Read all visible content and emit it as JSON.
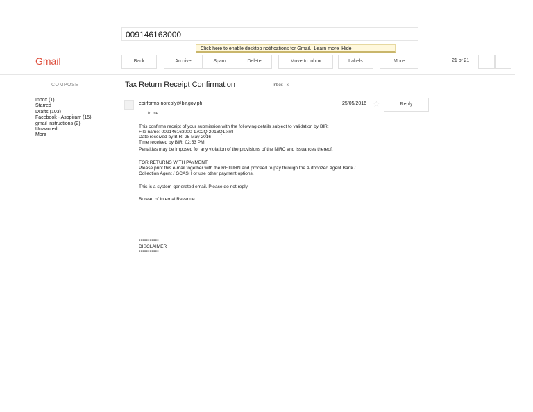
{
  "search": {
    "value": "009146163000"
  },
  "notification": {
    "link": "Click here to enable",
    "text": " desktop notifications for Gmail.",
    "learn_more": "Learn more",
    "hide": "Hide"
  },
  "logo": "Gmail",
  "toolbar": {
    "back": "Back",
    "archive": "Archive",
    "spam": "Spam",
    "delete": "Delete",
    "move_to_inbox": "Move to Inbox",
    "labels": "Labels",
    "more": "More",
    "pager": "21 of 21"
  },
  "compose": "COMPOSE",
  "nav": [
    "Inbox (1)",
    "Starred",
    "Drafts (103)",
    "Facebook - Asopiram (15)",
    "gmail instructions (2)",
    "Unwanted",
    "More"
  ],
  "message": {
    "subject": "Tax Return Receipt Confirmation",
    "label": "Inbox",
    "label_x": "x",
    "sender": "ebirforms-noreply@bir.gov.ph",
    "to": "to me",
    "date": "25/05/2016",
    "reply": "Reply",
    "body": {
      "p1": [
        "This confirms receipt of your submission with the following details subject to validation by BIR:",
        "File name:     009146163000-1702Q-2016Q1.xml",
        "Date received by BIR:   25 May 2016",
        "Time received by BIR:   02:53 PM",
        "Penalties may be imposed for any violation of the provisions of the NIRC and issuances thereof."
      ],
      "p2": [
        "FOR RETURNS WITH PAYMENT",
        "Please print this e-mail together with the RETURN and proceed to pay through the Authorized Agent Bank /",
        "Collection Agent / GCASH or use other payment options."
      ],
      "p3": "This is a system-generated email. Please do not reply.",
      "p4": "Bureau of Internal Revenue",
      "separator": "-----------",
      "disclaimer": "DISCLAIMER"
    }
  }
}
